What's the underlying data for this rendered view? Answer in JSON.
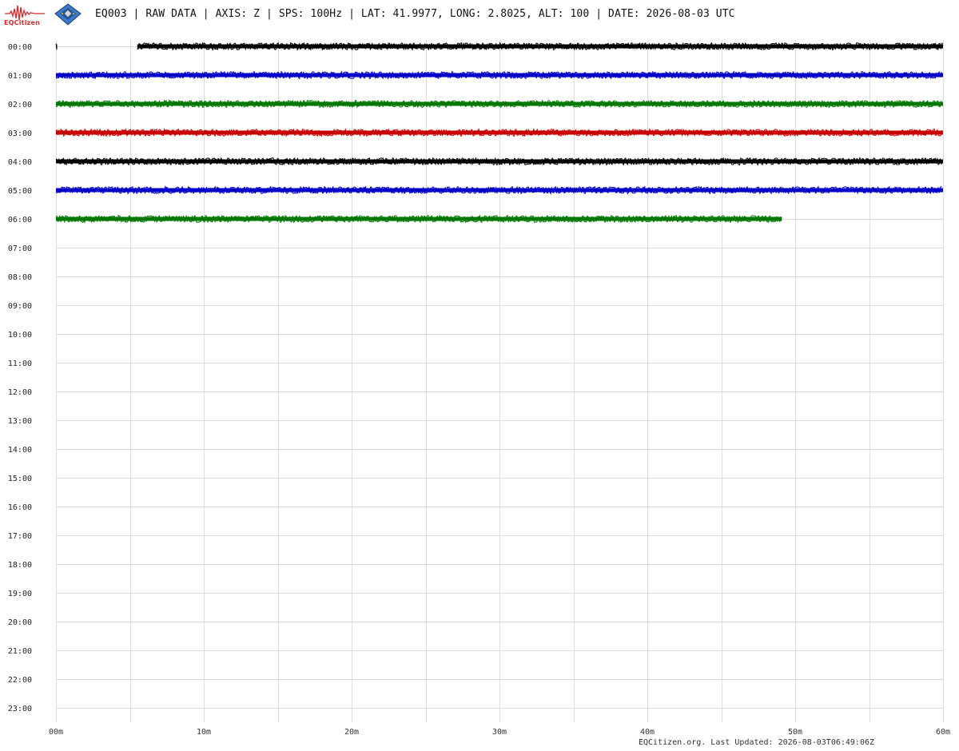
{
  "header": {
    "logo_text": "EQCitizen",
    "title": "EQ003 | RAW DATA | AXIS: Z | SPS: 100Hz | LAT: 41.9977, LONG: 2.8025, ALT: 100 | DATE: 2026-08-03 UTC"
  },
  "footer": {
    "text": "EQCitizen.org. Last Updated: 2026-08-03T06:49:06Z"
  },
  "chart_data": {
    "type": "line",
    "title": "EQ003 | RAW DATA | AXIS: Z | SPS: 100Hz | LAT: 41.9977, LONG: 2.8025, ALT: 100 | DATE: 2026-08-03 UTC",
    "xlabel": "",
    "ylabel": "",
    "x_ticks": [
      "00m",
      "10m",
      "20m",
      "30m",
      "40m",
      "50m",
      "60m"
    ],
    "xlim": [
      0,
      60
    ],
    "x_grid_minutes": [
      0,
      5,
      10,
      15,
      20,
      25,
      30,
      35,
      40,
      45,
      50,
      55,
      60
    ],
    "y_ticks": [
      "00:00",
      "01:00",
      "02:00",
      "03:00",
      "04:00",
      "05:00",
      "06:00",
      "07:00",
      "08:00",
      "09:00",
      "10:00",
      "11:00",
      "12:00",
      "13:00",
      "14:00",
      "15:00",
      "16:00",
      "17:00",
      "18:00",
      "19:00",
      "20:00",
      "21:00",
      "22:00",
      "23:00"
    ],
    "grid": true,
    "colors": [
      "#000000",
      "#0000c8",
      "#007800",
      "#c80000"
    ],
    "series": [
      {
        "row": "00:00",
        "segments": [
          [
            0,
            0.05
          ],
          [
            5.5,
            60
          ]
        ],
        "color": "#000000"
      },
      {
        "row": "01:00",
        "segments": [
          [
            0,
            60
          ]
        ],
        "color": "#0000c8"
      },
      {
        "row": "02:00",
        "segments": [
          [
            0,
            60
          ]
        ],
        "color": "#007800"
      },
      {
        "row": "03:00",
        "segments": [
          [
            0,
            60
          ]
        ],
        "color": "#c80000"
      },
      {
        "row": "04:00",
        "segments": [
          [
            0,
            60
          ]
        ],
        "color": "#000000"
      },
      {
        "row": "05:00",
        "segments": [
          [
            0,
            60
          ]
        ],
        "color": "#0000c8"
      },
      {
        "row": "06:00",
        "segments": [
          [
            0,
            49.1
          ]
        ],
        "color": "#007800"
      }
    ]
  }
}
